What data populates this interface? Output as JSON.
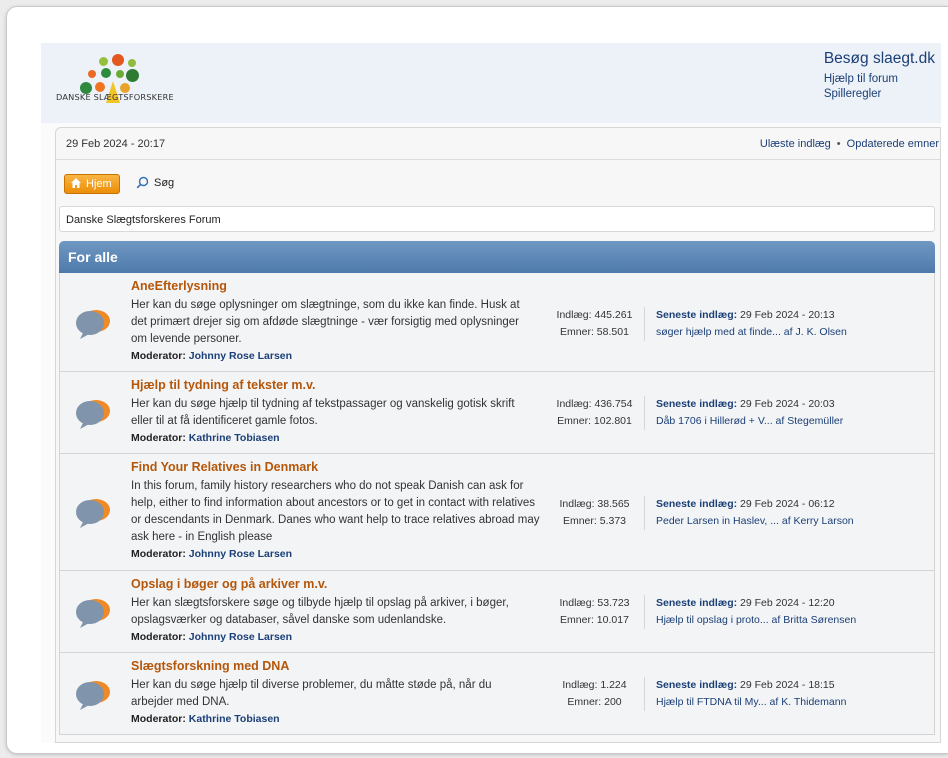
{
  "header": {
    "logo_text": "DANSKE SLÆGTSFORSKERE",
    "visit_link": "Besøg slaegt.dk",
    "help_link": "Hjælp til forum",
    "rules_link": "Spilleregler"
  },
  "navbar": {
    "date": "29 Feb 2024 - 20:17",
    "unread": "Ulæste indlæg",
    "separator": "•",
    "updated": "Opdaterede emner",
    "home_label": "Hjem",
    "search_label": "Søg"
  },
  "breadcrumb": "Danske Slægtsforskeres Forum",
  "section_title": "For alle",
  "colors": {
    "accent_orange": "#ec8e08",
    "forum_title": "#b5570a",
    "link_blue": "#1b3f77",
    "header_blue": "#5c86b5"
  },
  "forums": [
    {
      "title": "AneEfterlysning",
      "desc": "Her kan du søge oplysninger om slægtninge, som du ikke kan finde. Husk at det primært drejer sig om afdøde slægtninge - vær forsigtig med oplysninger om levende personer.",
      "moderator_label": "Moderator:",
      "moderator": "Johnny Rose Larsen",
      "posts": "Indlæg: 445.261",
      "topics": "Emner: 58.501",
      "last_label": "Seneste indlæg:",
      "last_date": "29 Feb 2024 - 20:13",
      "last_post": "søger hjælp med at finde... af J. K. Olsen"
    },
    {
      "title": "Hjælp til tydning af tekster m.v.",
      "desc": "Her kan du søge hjælp til tydning af tekstpassager og vanskelig gotisk skrift eller til at få identificeret gamle fotos.",
      "moderator_label": "Moderator:",
      "moderator": "Kathrine Tobiasen",
      "posts": "Indlæg: 436.754",
      "topics": "Emner: 102.801",
      "last_label": "Seneste indlæg:",
      "last_date": "29 Feb 2024 - 20:03",
      "last_post": "Dåb 1706 i Hillerød + V... af Stegemüller"
    },
    {
      "title": "Find Your Relatives in Denmark",
      "desc": "In this forum, family history researchers who do not speak Danish can ask for help, either to find information about ancestors or to get in contact with relatives or descendants in Denmark. Danes who want help to trace relatives abroad may ask here - in English please",
      "moderator_label": "Moderator:",
      "moderator": "Johnny Rose Larsen",
      "posts": "Indlæg: 38.565",
      "topics": "Emner: 5.373",
      "last_label": "Seneste indlæg:",
      "last_date": "29 Feb 2024 - 06:12",
      "last_post": "Peder Larsen in Haslev, ... af Kerry Larson"
    },
    {
      "title": "Opslag i bøger og på arkiver m.v.",
      "desc": "Her kan slægtsforskere søge og tilbyde hjælp til opslag på arkiver, i bøger, opslagsværker og databaser, såvel danske som udenlandske.",
      "moderator_label": "Moderator:",
      "moderator": "Johnny Rose Larsen",
      "posts": "Indlæg: 53.723",
      "topics": "Emner: 10.017",
      "last_label": "Seneste indlæg:",
      "last_date": "29 Feb 2024 - 12:20",
      "last_post": "Hjælp til opslag i proto... af Britta Sørensen"
    },
    {
      "title": "Slægtsforskning med DNA",
      "desc": "Her kan du søge hjælp til diverse problemer, du måtte støde på, når du arbejder med DNA.",
      "moderator_label": "Moderator:",
      "moderator": "Kathrine Tobiasen",
      "posts": "Indlæg: 1.224",
      "topics": "Emner: 200",
      "last_label": "Seneste indlæg:",
      "last_date": "29 Feb 2024 - 18:15",
      "last_post": "Hjælp til FTDNA til My... af K. Thidemann"
    }
  ]
}
